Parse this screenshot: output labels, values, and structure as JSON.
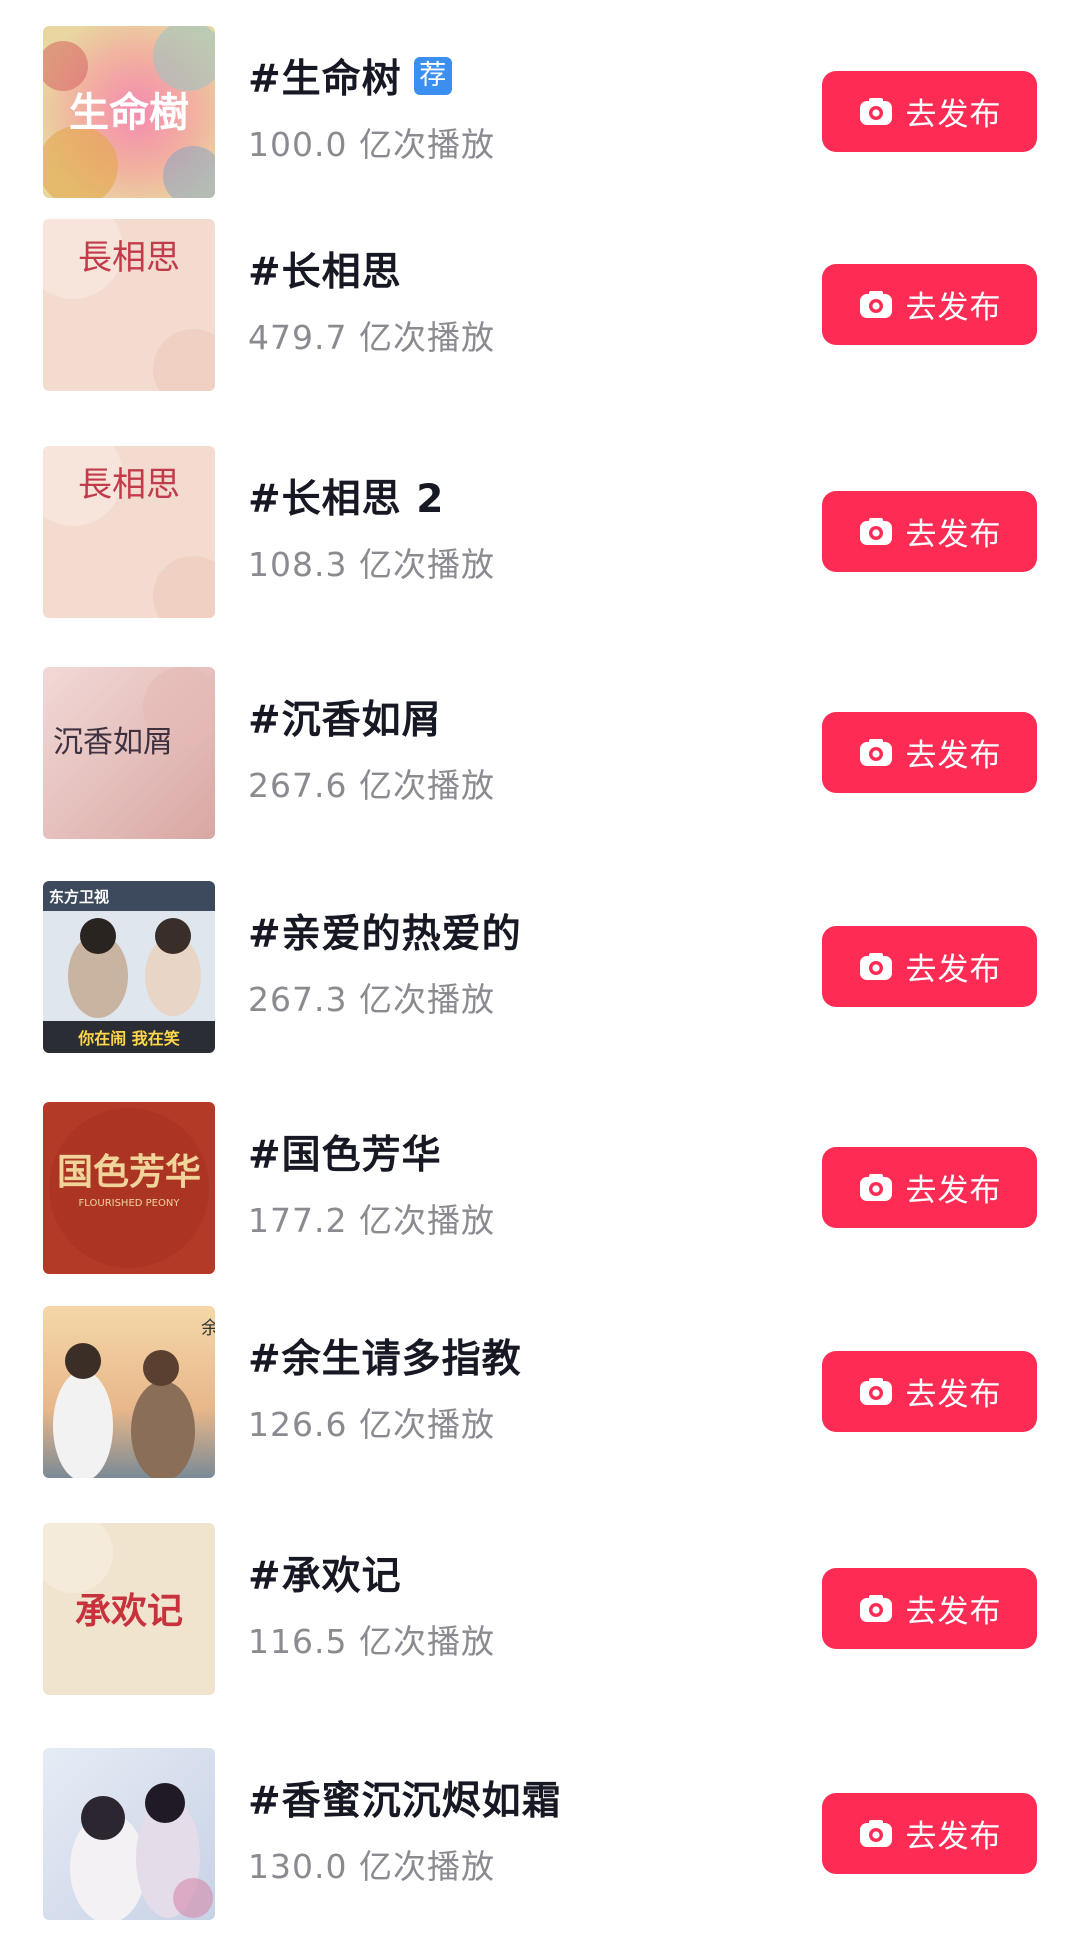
{
  "topics": [
    {
      "title": "#生命树",
      "badge": "荐",
      "plays": "100.0 亿次播放",
      "button_label": "去发布",
      "thumb_text": "生命樹"
    },
    {
      "title": "#长相思",
      "plays": "479.7 亿次播放",
      "button_label": "去发布",
      "thumb_text": "長相思"
    },
    {
      "title": "#长相思 2",
      "plays": "108.3 亿次播放",
      "button_label": "去发布",
      "thumb_text": "長相思"
    },
    {
      "title": "#沉香如屑",
      "plays": "267.6 亿次播放",
      "button_label": "去发布",
      "thumb_text": "沉香如屑"
    },
    {
      "title": "#亲爱的热爱的",
      "plays": "267.3 亿次播放",
      "button_label": "去发布",
      "thumb_text": "你在闹 我在笑",
      "thumb_logo": "东方卫视"
    },
    {
      "title": "#国色芳华",
      "plays": "177.2 亿次播放",
      "button_label": "去发布",
      "thumb_text": "国色芳华",
      "thumb_subtext": "FLOURISHED PEONY"
    },
    {
      "title": "#余生请多指教",
      "plays": "126.6 亿次播放",
      "button_label": "去发布",
      "thumb_text": "余生"
    },
    {
      "title": "#承欢记",
      "plays": "116.5 亿次播放",
      "button_label": "去发布",
      "thumb_text": "承欢记"
    },
    {
      "title": "#香蜜沉沉烬如霜",
      "plays": "130.0 亿次播放",
      "button_label": "去发布"
    }
  ],
  "colors": {
    "button": "#fe2c55",
    "title": "#161823",
    "plays": "#8a8b91",
    "badge": "#3b8ff0"
  }
}
